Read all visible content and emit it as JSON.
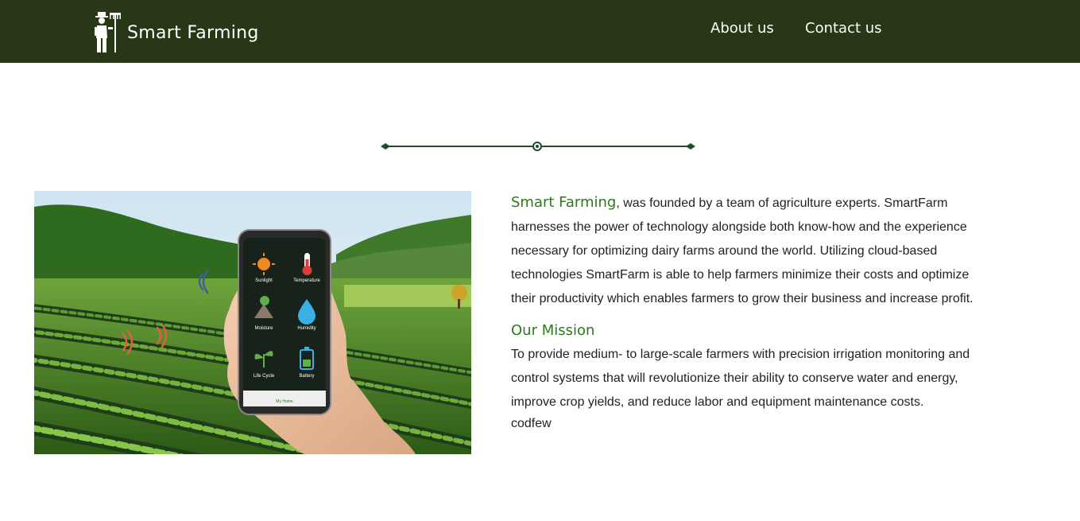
{
  "navbar": {
    "brand_name": "Smart Farming",
    "logo_icon": "farmer-icon",
    "links": [
      {
        "label": "About us"
      },
      {
        "label": "Contact us"
      }
    ],
    "background_color": "#283816"
  },
  "divider": {
    "color": "#1b4d2a",
    "icon": "ornamental-divider-icon"
  },
  "about": {
    "image_description": "hand-holding-phone-with-smart-farming-app-over-crop-field",
    "brand_highlight": "Smart Farming",
    "intro_rest": ", was founded by a team of agriculture experts. SmartFarm harnesses the power of technology alongside both know-how and the experience necessary for optimizing dairy farms around the world. Utilizing cloud-based technologies SmartFarm is able to help farmers minimize their costs and optimize their productivity which enables farmers to grow their business and increase profit.",
    "mission_heading": "Our Mission",
    "mission_text": "To provide medium- to large-scale farmers with precision irrigation monitoring and control systems that will revolutionize their ability to conserve water and energy, improve crop yields, and reduce labor and equipment maintenance costs.",
    "extra_text": "codfew",
    "accent_color": "#2d7a1a"
  },
  "app_screen": {
    "tiles": [
      {
        "label": "Sunlight",
        "icon": "sun-icon"
      },
      {
        "label": "Temperature",
        "icon": "thermometer-icon"
      },
      {
        "label": "Moisture",
        "icon": "soil-moisture-icon"
      },
      {
        "label": "Humidity",
        "icon": "water-drop-icon"
      },
      {
        "label": "Life Cycle",
        "icon": "sprout-icon"
      },
      {
        "label": "Battery",
        "icon": "battery-icon"
      }
    ],
    "bottom_tab_label": "My Home"
  }
}
